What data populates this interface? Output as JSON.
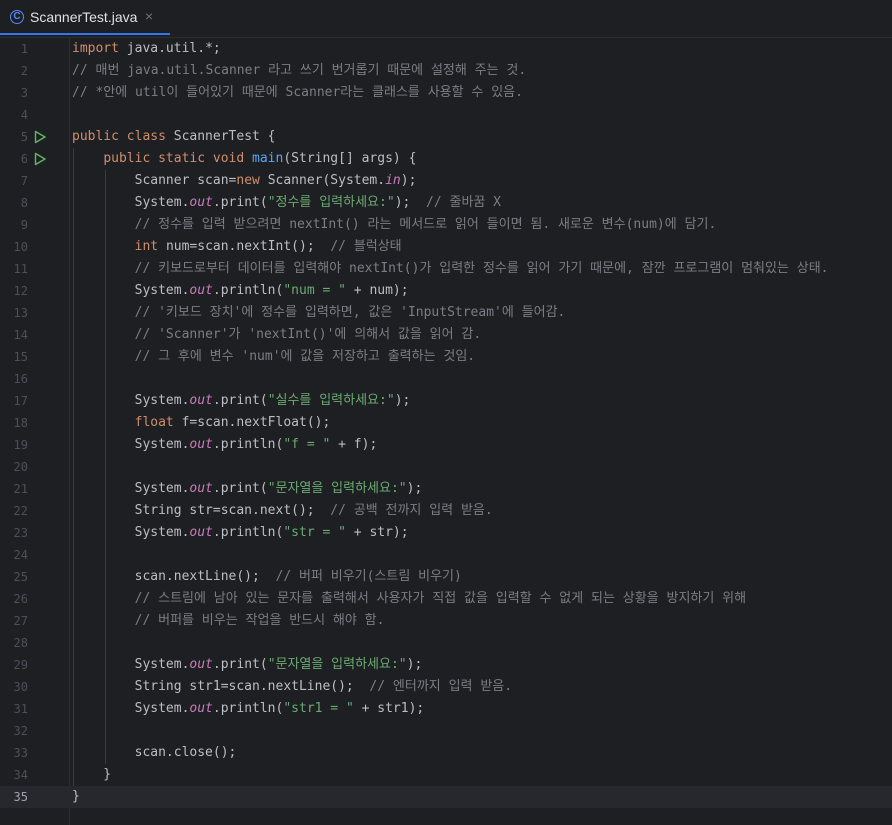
{
  "tab": {
    "icon": "java-class-icon",
    "icon_glyph": "C",
    "file_name": "ScannerTest.java",
    "close_glyph": "×"
  },
  "editor": {
    "current_line": 35,
    "run_markers": [
      5,
      6
    ],
    "lines": [
      {
        "n": "1",
        "segs": [
          {
            "t": "import ",
            "c": "kw"
          },
          {
            "t": "java.util.*;",
            "c": "pl"
          }
        ]
      },
      {
        "n": "2",
        "segs": [
          {
            "t": "// 매번 java.util.Scanner 라고 쓰기 번거롭기 때문에 설정해 주는 것.",
            "c": "cm"
          }
        ]
      },
      {
        "n": "3",
        "segs": [
          {
            "t": "// *안에 util이 들어있기 때문에 Scanner라는 클래스를 사용할 수 있음.",
            "c": "cm"
          }
        ]
      },
      {
        "n": "4",
        "segs": []
      },
      {
        "n": "5",
        "segs": [
          {
            "t": "public class ",
            "c": "kw"
          },
          {
            "t": "ScannerTest {",
            "c": "pl"
          }
        ]
      },
      {
        "n": "6",
        "segs": [
          {
            "t": "    "
          },
          {
            "t": "public static void ",
            "c": "kw"
          },
          {
            "t": "main",
            "c": "fn"
          },
          {
            "t": "(String[] args) {",
            "c": "pl"
          }
        ]
      },
      {
        "n": "7",
        "segs": [
          {
            "t": "        Scanner scan=",
            "c": "pl"
          },
          {
            "t": "new ",
            "c": "kw"
          },
          {
            "t": "Scanner(System.",
            "c": "pl"
          },
          {
            "t": "in",
            "c": "fld"
          },
          {
            "t": ");",
            "c": "pl"
          }
        ]
      },
      {
        "n": "8",
        "segs": [
          {
            "t": "        System.",
            "c": "pl"
          },
          {
            "t": "out",
            "c": "fld"
          },
          {
            "t": ".print(",
            "c": "pl"
          },
          {
            "t": "\"정수를 입력하세요:\"",
            "c": "str"
          },
          {
            "t": ");  ",
            "c": "pl"
          },
          {
            "t": "// 줄바꿈 X",
            "c": "cm"
          }
        ]
      },
      {
        "n": "9",
        "segs": [
          {
            "t": "        "
          },
          {
            "t": "// 정수를 입력 받으려면 nextInt() 라는 메서드로 읽어 들이면 됨. 새로운 변수(num)에 담기.",
            "c": "cm"
          }
        ]
      },
      {
        "n": "10",
        "segs": [
          {
            "t": "        "
          },
          {
            "t": "int ",
            "c": "kw"
          },
          {
            "t": "num=scan.nextInt();  ",
            "c": "pl"
          },
          {
            "t": "// 블럭상태",
            "c": "cm"
          }
        ]
      },
      {
        "n": "11",
        "segs": [
          {
            "t": "        "
          },
          {
            "t": "// 키보드로부터 데이터를 입력해야 nextInt()가 입력한 정수를 읽어 가기 때문에, 잠깐 프로그램이 멈춰있는 상태.",
            "c": "cm"
          }
        ]
      },
      {
        "n": "12",
        "segs": [
          {
            "t": "        System.",
            "c": "pl"
          },
          {
            "t": "out",
            "c": "fld"
          },
          {
            "t": ".println(",
            "c": "pl"
          },
          {
            "t": "\"num = \"",
            "c": "str"
          },
          {
            "t": " + num);",
            "c": "pl"
          }
        ]
      },
      {
        "n": "13",
        "segs": [
          {
            "t": "        "
          },
          {
            "t": "// '키보드 장치'에 정수를 입력하면, 값은 'InputStream'에 들어감.",
            "c": "cm"
          }
        ]
      },
      {
        "n": "14",
        "segs": [
          {
            "t": "        "
          },
          {
            "t": "// 'Scanner'가 'nextInt()'에 의해서 값을 읽어 감.",
            "c": "cm"
          }
        ]
      },
      {
        "n": "15",
        "segs": [
          {
            "t": "        "
          },
          {
            "t": "// 그 후에 변수 'num'에 값을 저장하고 출력하는 것임.",
            "c": "cm"
          }
        ]
      },
      {
        "n": "16",
        "segs": []
      },
      {
        "n": "17",
        "segs": [
          {
            "t": "        System.",
            "c": "pl"
          },
          {
            "t": "out",
            "c": "fld"
          },
          {
            "t": ".print(",
            "c": "pl"
          },
          {
            "t": "\"실수를 입력하세요:\"",
            "c": "str"
          },
          {
            "t": ");",
            "c": "pl"
          }
        ]
      },
      {
        "n": "18",
        "segs": [
          {
            "t": "        "
          },
          {
            "t": "float ",
            "c": "kw"
          },
          {
            "t": "f=scan.nextFloat();",
            "c": "pl"
          }
        ]
      },
      {
        "n": "19",
        "segs": [
          {
            "t": "        System.",
            "c": "pl"
          },
          {
            "t": "out",
            "c": "fld"
          },
          {
            "t": ".println(",
            "c": "pl"
          },
          {
            "t": "\"f = \"",
            "c": "str"
          },
          {
            "t": " + f);",
            "c": "pl"
          }
        ]
      },
      {
        "n": "20",
        "segs": []
      },
      {
        "n": "21",
        "segs": [
          {
            "t": "        System.",
            "c": "pl"
          },
          {
            "t": "out",
            "c": "fld"
          },
          {
            "t": ".print(",
            "c": "pl"
          },
          {
            "t": "\"문자열을 입력하세요:\"",
            "c": "str"
          },
          {
            "t": ");",
            "c": "pl"
          }
        ]
      },
      {
        "n": "22",
        "segs": [
          {
            "t": "        String str=scan.next();  ",
            "c": "pl"
          },
          {
            "t": "// 공백 전까지 입력 받음.",
            "c": "cm"
          }
        ]
      },
      {
        "n": "23",
        "segs": [
          {
            "t": "        System.",
            "c": "pl"
          },
          {
            "t": "out",
            "c": "fld"
          },
          {
            "t": ".println(",
            "c": "pl"
          },
          {
            "t": "\"str = \"",
            "c": "str"
          },
          {
            "t": " + str);",
            "c": "pl"
          }
        ]
      },
      {
        "n": "24",
        "segs": []
      },
      {
        "n": "25",
        "segs": [
          {
            "t": "        scan.nextLine();  ",
            "c": "pl"
          },
          {
            "t": "// 버퍼 비우기(스트림 비우기)",
            "c": "cm"
          }
        ]
      },
      {
        "n": "26",
        "segs": [
          {
            "t": "        "
          },
          {
            "t": "// 스트림에 남아 있는 문자를 출력해서 사용자가 직접 값을 입력할 수 없게 되는 상황을 방지하기 위해",
            "c": "cm"
          }
        ]
      },
      {
        "n": "27",
        "segs": [
          {
            "t": "        "
          },
          {
            "t": "// 버퍼를 비우는 작업을 반드시 해야 함.",
            "c": "cm"
          }
        ]
      },
      {
        "n": "28",
        "segs": []
      },
      {
        "n": "29",
        "segs": [
          {
            "t": "        System.",
            "c": "pl"
          },
          {
            "t": "out",
            "c": "fld"
          },
          {
            "t": ".print(",
            "c": "pl"
          },
          {
            "t": "\"문자열을 입력하세요:\"",
            "c": "str"
          },
          {
            "t": ");",
            "c": "pl"
          }
        ]
      },
      {
        "n": "30",
        "segs": [
          {
            "t": "        String str1=scan.nextLine();  ",
            "c": "pl"
          },
          {
            "t": "// 엔터까지 입력 받음.",
            "c": "cm"
          }
        ]
      },
      {
        "n": "31",
        "segs": [
          {
            "t": "        System.",
            "c": "pl"
          },
          {
            "t": "out",
            "c": "fld"
          },
          {
            "t": ".println(",
            "c": "pl"
          },
          {
            "t": "\"str1 = \"",
            "c": "str"
          },
          {
            "t": " + str1);",
            "c": "pl"
          }
        ]
      },
      {
        "n": "32",
        "segs": []
      },
      {
        "n": "33",
        "segs": [
          {
            "t": "        scan.close();",
            "c": "pl"
          }
        ]
      },
      {
        "n": "34",
        "segs": [
          {
            "t": "    }",
            "c": "pl"
          }
        ]
      },
      {
        "n": "35",
        "segs": [
          {
            "t": "}",
            "c": "pl"
          }
        ]
      }
    ]
  },
  "colors": {
    "background": "#1e1f22",
    "keyword": "#cf8e6d",
    "string": "#6aab73",
    "comment": "#7a7e85",
    "static_field": "#c77dbb",
    "method_decl": "#56a8f5",
    "run_marker": "#5fb865",
    "tab_accent": "#3574f0"
  }
}
